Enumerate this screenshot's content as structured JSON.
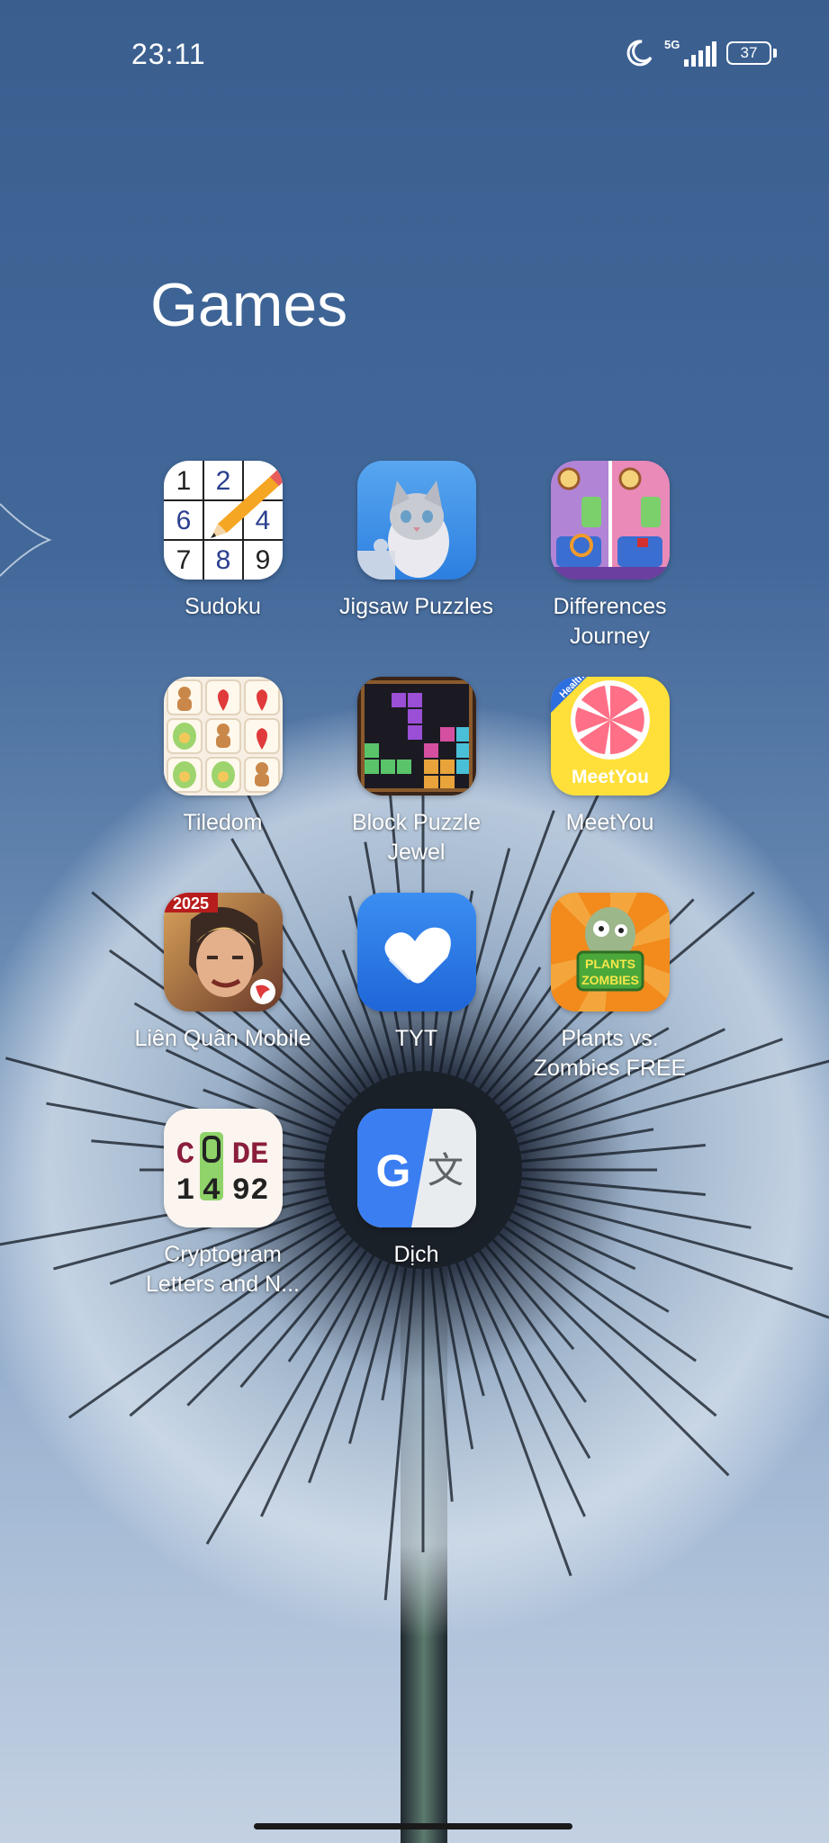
{
  "status_bar": {
    "time": "23:11",
    "network": "5G",
    "battery": "37",
    "icons": [
      "moon-icon",
      "signal-icon",
      "battery-icon"
    ]
  },
  "folder": {
    "title": "Games"
  },
  "apps": [
    {
      "label": "Sudoku",
      "icon": "sudoku-icon"
    },
    {
      "label": "Jigsaw Puzzles",
      "icon": "jigsaw-puzzles-icon"
    },
    {
      "label": "Differences Journey",
      "icon": "differences-journey-icon"
    },
    {
      "label": "Tiledom",
      "icon": "tiledom-icon"
    },
    {
      "label": "Block Puzzle Jewel",
      "icon": "block-puzzle-jewel-icon"
    },
    {
      "label": "MeetYou",
      "icon": "meetyou-icon"
    },
    {
      "label": "Liên Quân Mobile",
      "icon": "lien-quan-mobile-icon"
    },
    {
      "label": "TYT",
      "icon": "tyt-icon"
    },
    {
      "label": "Plants vs. Zombies FREE",
      "icon": "plants-vs-zombies-icon"
    },
    {
      "label": "Cryptogram Letters and N...",
      "icon": "cryptogram-icon"
    },
    {
      "label": "Dịch",
      "icon": "google-translate-icon"
    }
  ],
  "icon_text": {
    "sudoku_digits": [
      "1",
      "2",
      "6",
      "4",
      "7",
      "8",
      "9"
    ],
    "meetyou_badge": "Health",
    "meetyou_brand": "MeetYou",
    "lienquan_year": "2025",
    "pvz_line1": "PLANTS",
    "pvz_line2": "ZOMBIES",
    "crypto_line1a": "C",
    "crypto_line1b": "DE",
    "crypto_line2a": "1",
    "crypto_line2b": "4",
    "crypto_line2c": "92",
    "translate_g": "G",
    "translate_char": "文"
  },
  "colors": {
    "wallpaper_top": "#3a5f8f",
    "wallpaper_bottom": "#c3d1e2",
    "text": "#ffffff"
  }
}
